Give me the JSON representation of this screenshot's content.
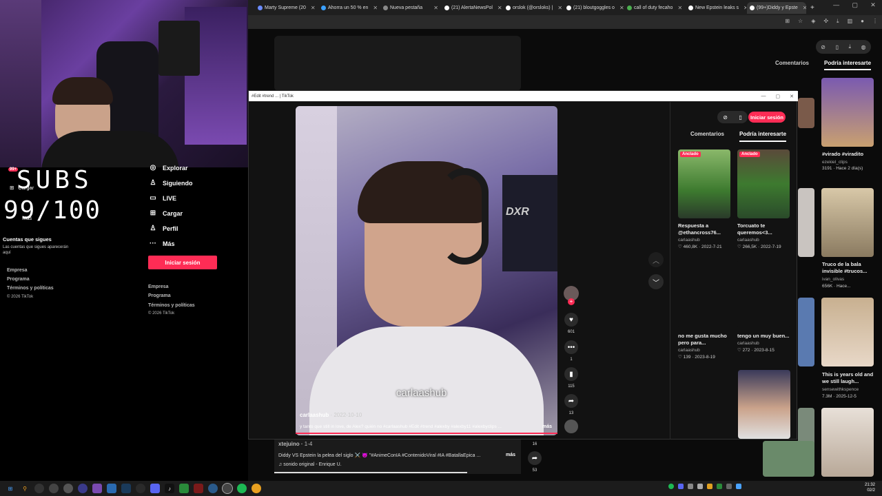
{
  "browser": {
    "tabs": [
      {
        "label": "Marty Supreme (20",
        "color": "#6b8cff"
      },
      {
        "label": "Ahorra un 50 % en",
        "color": "#3aa0ff"
      },
      {
        "label": "Nueva pestaña",
        "color": "#888888"
      },
      {
        "label": "(21) AlertaNewsPol",
        "color": "#ffffff"
      },
      {
        "label": "orslok (@orsloks) |",
        "color": "#ffffff"
      },
      {
        "label": "(21) bloutgoggles o",
        "color": "#ffffff"
      },
      {
        "label": "call of duty fecaho",
        "color": "#4caf50"
      },
      {
        "label": "New Epstein leaks s",
        "color": "#ffffff"
      },
      {
        "label": "(99+)Diddy y Epste",
        "color": "#ffffff"
      }
    ],
    "close_glyph": "✕",
    "new_tab": "+"
  },
  "overlay": {
    "subs_line1": "SUBS",
    "subs_line2": "99/100",
    "badge": "99+",
    "cargar_small": "Cargar",
    "mas_small": "Más",
    "following_heading": "Cuentas que sigues",
    "following_text": "Las cuentas que sigues aparecerán aquí",
    "footer": [
      "Empresa",
      "Programa",
      "Términos y políticas",
      "© 2026 TikTok"
    ]
  },
  "sidebar": {
    "items": [
      {
        "label": "Explorar",
        "icon": "compass-icon"
      },
      {
        "label": "Siguiendo",
        "icon": "user-icon"
      },
      {
        "label": "LIVE",
        "icon": "live-icon"
      },
      {
        "label": "Cargar",
        "icon": "upload-icon"
      },
      {
        "label": "Perfil",
        "icon": "profile-icon"
      },
      {
        "label": "Más",
        "icon": "more-icon"
      }
    ],
    "login_label": "Iniciar sesión",
    "footer": [
      "Empresa",
      "Programa",
      "Términos y políticas",
      "© 2026 TikTok"
    ]
  },
  "popup": {
    "title": "#Edit #trend ... | TikTok",
    "login_label": "Iniciar sesión",
    "tabs": [
      "Comentarios",
      "Podría interesarte"
    ],
    "video": {
      "watermark": "carlaashub",
      "author": "carlaashub",
      "date": "2022-10-10",
      "caption": "y tanto que still in love, de Alex? quién no #carlaashub #Edit #trend #alexby #alexby11 #alexbyclips ...",
      "more": "más"
    },
    "actions": {
      "likes": "601",
      "comments": "1",
      "saves": "115",
      "shares": "13"
    },
    "cards": [
      {
        "pinned": "Anclado",
        "title": "Respuesta a @ethancross76...",
        "author": "carlaashub",
        "likes": "460,8K",
        "date": "2022-7-21",
        "color": "#4a8f3a"
      },
      {
        "pinned": "Anclado",
        "title": "Torcuato te queremos<3...",
        "author": "carlaashub",
        "likes": "266,5K",
        "date": "2022-7-19",
        "color": "#3d7a2f"
      },
      {
        "pinned": "",
        "title": "no me gusta mucho pero para...",
        "author": "carlaashub",
        "likes": "139",
        "date": "2023-8-19",
        "color": "#121212"
      },
      {
        "pinned": "",
        "title": "tengo un muy buen...",
        "author": "carlaashub",
        "likes": "272",
        "date": "2023-8-15",
        "color": "#121212"
      }
    ]
  },
  "background_page": {
    "tabs": [
      "Comentarios",
      "Podría interesarte"
    ],
    "post": {
      "author": "xtejuino",
      "date": "1-4",
      "caption": "Diddy VS Epstein la pelea del siglo ⚔️ 😈 \"#AnimeConIA #ContenidoViral #IA #BatallaEpica ...",
      "more": "más",
      "sound": "sonido original - Enrique U.",
      "count_top": "16",
      "count_bottom": "53"
    },
    "right_cards": [
      {
        "title": "#virado #viradito",
        "author": "ezekiel_clips",
        "meta": "3191 · Hace 2 día(s)"
      },
      {
        "title": "Truco de la bala invisible #trucos...",
        "author": "ivan_olivas",
        "meta": "656K · Hace..."
      },
      {
        "title": "This is years old and we still laugh...",
        "author": "sensewithkspence",
        "meta": "7.3M · 2025-12-5"
      }
    ]
  },
  "taskbar": {
    "time": "21:32",
    "date": "02/2"
  }
}
